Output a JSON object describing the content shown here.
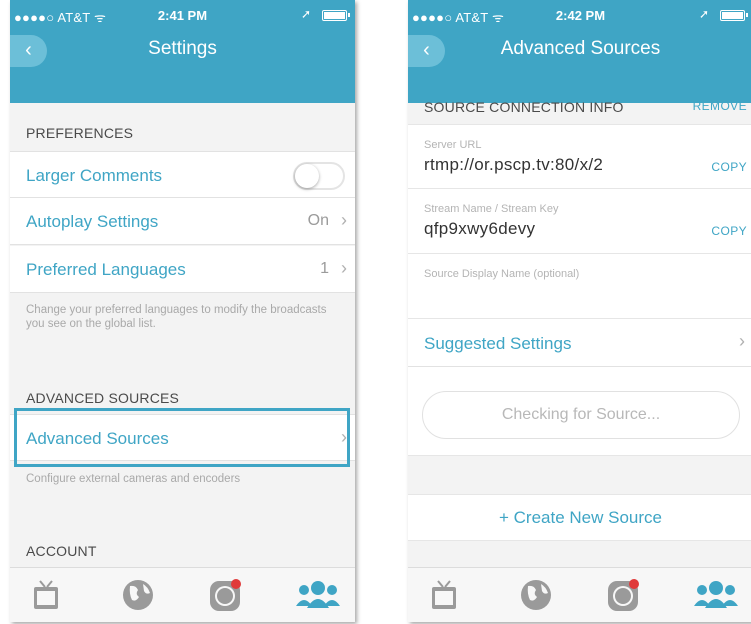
{
  "status_left": {
    "carrier": "●●●●○ AT&T ᯤ",
    "time": "2:41 PM",
    "location": "➚"
  },
  "status_right": {
    "carrier": "●●●●○ AT&T ᯤ",
    "time": "2:42 PM",
    "location": "➚"
  },
  "settings": {
    "title": "Settings",
    "back": "‹",
    "preferences_header": "PREFERENCES",
    "larger_comments": "Larger Comments",
    "autoplay_label": "Autoplay Settings",
    "autoplay_value": "On",
    "languages_label": "Preferred Languages",
    "languages_value": "1",
    "languages_note": "Change your preferred languages to modify the broadcasts you see on the global list.",
    "advanced_header": "ADVANCED SOURCES",
    "advanced_label": "Advanced Sources",
    "advanced_note": "Configure external cameras and encoders",
    "account_header": "ACCOUNT",
    "chevron": "›"
  },
  "advanced": {
    "title": "Advanced Sources",
    "back": "‹",
    "connection_header": "SOURCE CONNECTION INFO",
    "remove": "REMOVE",
    "server_url_label": "Server URL",
    "server_url_value": "rtmp://or.pscp.tv:80/x/2",
    "stream_key_label": "Stream Name / Stream Key",
    "stream_key_value": "qfp9xwy6devy",
    "display_name_label": "Source Display Name (optional)",
    "copy": "COPY",
    "suggested": "Suggested Settings",
    "checking": "Checking for Source...",
    "create": "+ Create New Source",
    "chevron": "›"
  },
  "colors": {
    "accent": "#3fa5c5",
    "background": "#f3f3f3",
    "alert": "#e03a3a"
  },
  "tabs": [
    "tv-icon",
    "globe-icon",
    "camera-icon",
    "people-icon"
  ]
}
